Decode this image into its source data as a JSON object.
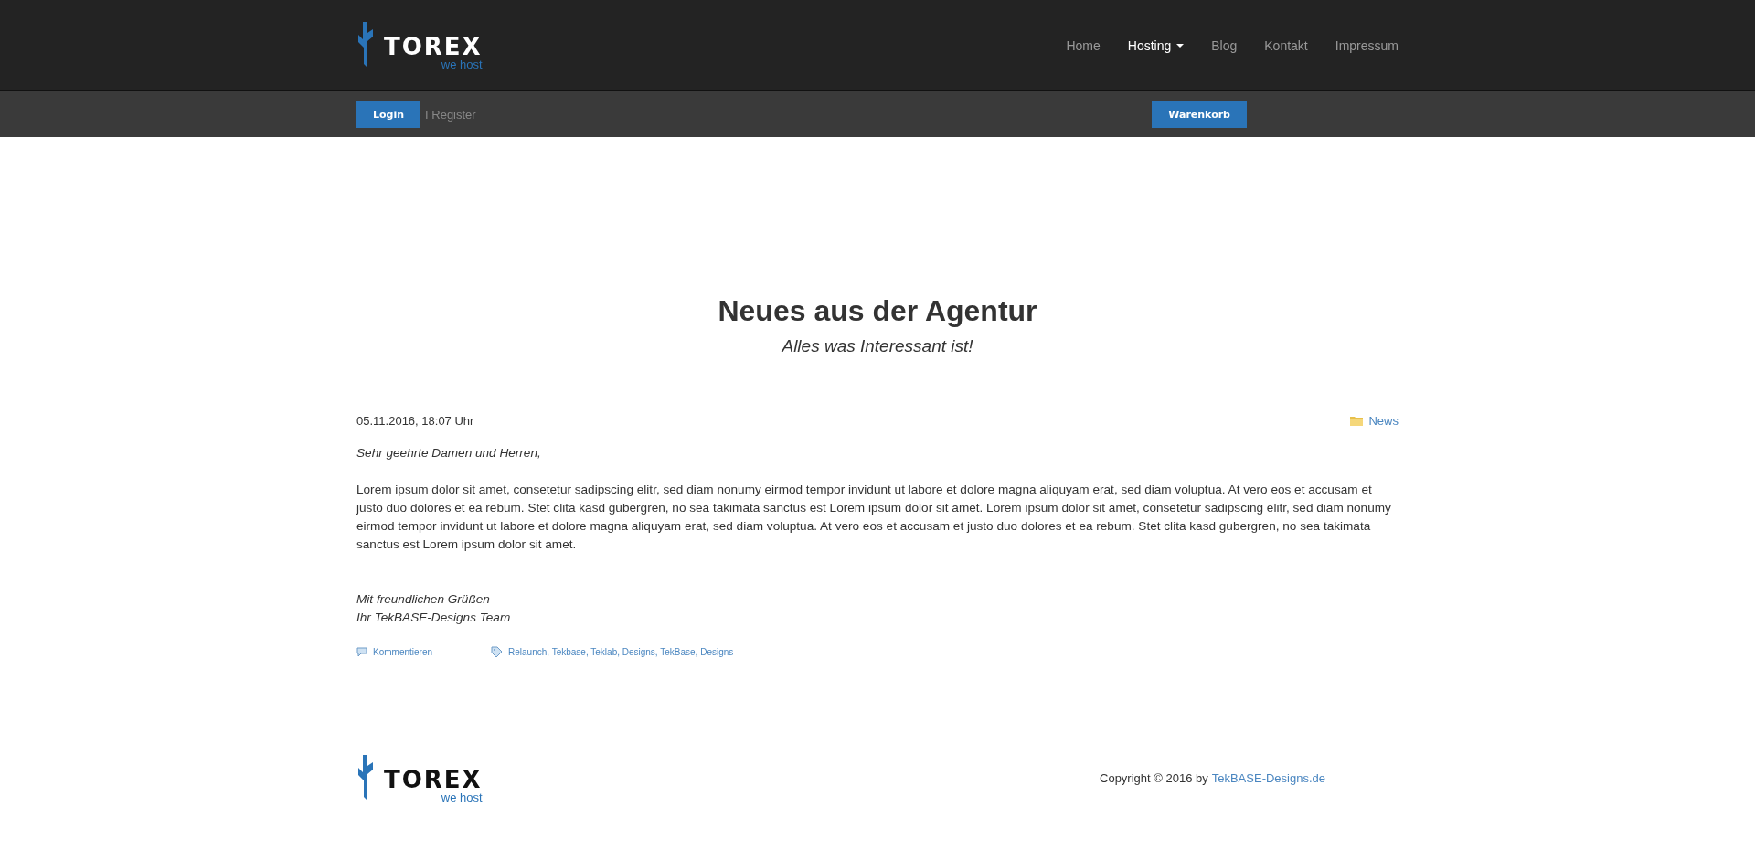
{
  "header": {
    "logo": {
      "name": "TOREX",
      "tagline": "we host"
    },
    "nav": [
      {
        "label": "Home",
        "selected": false,
        "dropdown": false
      },
      {
        "label": "Hosting",
        "selected": true,
        "dropdown": true
      },
      {
        "label": "Blog",
        "selected": false,
        "dropdown": false
      },
      {
        "label": "Kontakt",
        "selected": false,
        "dropdown": false
      },
      {
        "label": "Impressum",
        "selected": false,
        "dropdown": false
      }
    ]
  },
  "account_bar": {
    "login_button": "Login",
    "register_link": "I Register",
    "cart_button": "Warenkorb"
  },
  "hero": {
    "title": "Neues aus der Agentur",
    "subtitle": "Alles was Interessant ist!"
  },
  "post": {
    "date": "05.11.2016, 18:07 Uhr",
    "category": "News",
    "greeting": "Sehr geehrte Damen und Herren,",
    "body": "Lorem ipsum dolor sit amet, consetetur sadipscing elitr, sed diam nonumy eirmod tempor invidunt ut labore et dolore magna aliquyam erat, sed diam voluptua. At vero eos et accusam et justo duo dolores et ea rebum. Stet clita kasd gubergren, no sea takimata sanctus est Lorem ipsum dolor sit amet. Lorem ipsum dolor sit amet, consetetur sadipscing elitr, sed diam nonumy eirmod tempor invidunt ut labore et dolore magna aliquyam erat, sed diam voluptua. At vero eos et accusam et justo duo dolores et ea rebum. Stet clita kasd gubergren, no sea takimata sanctus est Lorem ipsum dolor sit amet.",
    "closing": [
      "Mit freundlichen Grüßen",
      "Ihr TekBASE-Designs Team"
    ],
    "comment_link": "Kommentieren",
    "tags": "Relaunch, Tekbase, Teklab, Designs, TekBase, Designs"
  },
  "footer": {
    "logo": {
      "name": "TOREX",
      "tagline": "we host"
    },
    "copyright": "Copyright © 2016 by",
    "copyright_link": "TekBASE-Designs.de"
  }
}
